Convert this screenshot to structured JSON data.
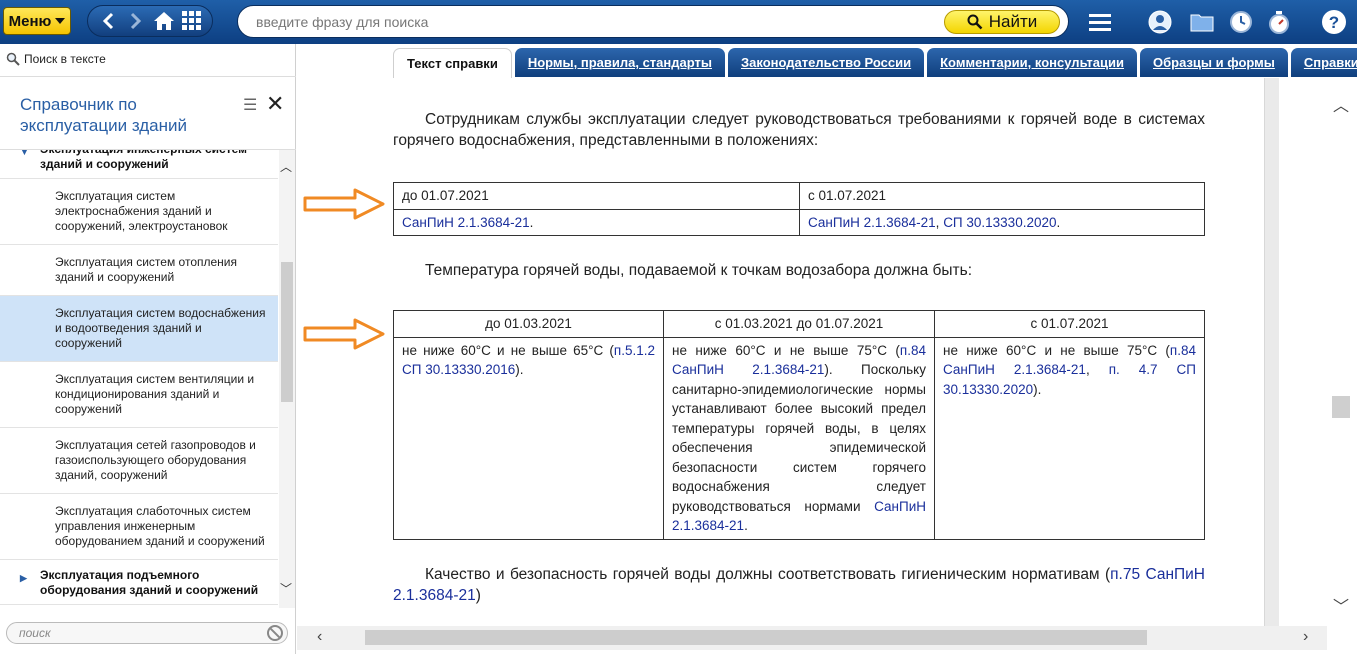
{
  "topbar": {
    "menu_label": "Меню",
    "search_placeholder": "введите фразу для поиска",
    "find_label": "Найти"
  },
  "left_panel": {
    "search_in_text_label": "Поиск в тексте",
    "title": "Справочник по эксплуатации зданий",
    "tree": [
      {
        "label": "Эксплуатация инженерных систем зданий и сооружений",
        "parent": true
      },
      {
        "label": "Эксплуатация систем электроснабжения зданий и сооружений, электроустановок"
      },
      {
        "label": "Эксплуатация систем отопления зданий и сооружений"
      },
      {
        "label": "Эксплуатация систем водоснабжения и водоотведения зданий и сооружений",
        "selected": true
      },
      {
        "label": "Эксплуатация систем вентиляции и кондиционирования зданий и сооружений"
      },
      {
        "label": "Эксплуатация сетей газопроводов и газоиспользующего оборудования зданий, сооружений"
      },
      {
        "label": "Эксплуатация слаботочных систем управления инженерным оборудованием зданий и сооружений"
      },
      {
        "label": "Эксплуатация подъемного оборудования зданий и сооружений",
        "parent": true
      }
    ],
    "filter_placeholder": "поиск"
  },
  "tabs": [
    {
      "label": "Текст справки",
      "active": true
    },
    {
      "label": "Нормы, правила, стандарты"
    },
    {
      "label": "Законодательство России"
    },
    {
      "label": "Комментарии, консультации"
    },
    {
      "label": "Образцы и формы"
    },
    {
      "label": "Справки"
    }
  ],
  "document": {
    "para1": "Сотрудникам службы эксплуатации следует руководствоваться требованиями к горячей воде в системах горячего водоснабжения, представленными в положениях:",
    "table1": {
      "headers": [
        "до 01.07.2021",
        "с 01.07.2021"
      ],
      "row": {
        "c1_link": "СанПиН 2.1.3684-21",
        "c1_tail": ".",
        "c2_link1": "СанПиН 2.1.3684-21",
        "c2_sep": ", ",
        "c2_link2": "СП 30.13330.2020",
        "c2_tail": "."
      }
    },
    "para2": "Температура горячей воды, подаваемой к точкам водозабора должна быть:",
    "table2": {
      "headers": [
        "до 01.03.2021",
        "с 01.03.2021 до 01.07.2021",
        "с 01.07.2021"
      ],
      "c1_text": "не ниже 60°С и не выше 65°С (",
      "c1_link": "п.5.1.2 СП 30.13330.2016",
      "c1_tail": ").",
      "c2_text": "не ниже 60°С и не выше 75°С (",
      "c2_link1": "п.84 СанПиН 2.1.3684-21",
      "c2_mid": "). Поскольку санитарно-эпидемиологические нормы устанавливают более высокий предел температуры горячей воды, в целях обеспечения эпидемической безопасности систем горячего водоснабжения следует руководствоваться нормами ",
      "c2_link2": "СанПиН 2.1.3684-21",
      "c2_tail": ".",
      "c3_text": "не ниже 60°С и не выше 75°С (",
      "c3_link1": "п.84 СанПиН 2.1.3684-21",
      "c3_sep": ", ",
      "c3_link2": "п. 4.7 СП 30.13330.2020",
      "c3_tail": ")."
    },
    "para3_text": "Качество и безопасность горячей воды должны соответствовать гигиеническим нормативам (",
    "para3_link": "п.75 СанПиН 2.1.3684-21",
    "para3_tail": ")"
  },
  "colors": {
    "topbar": "#1a5199",
    "accent_yellow": "#f5c400",
    "link": "#1a2f9b",
    "annotation_arrow": "#f08a24",
    "selected_item": "#cfe3f8"
  },
  "icons": [
    "back-icon",
    "forward-icon",
    "home-icon",
    "grid-icon",
    "search-icon",
    "hamburger-icon",
    "user-icon",
    "folder-icon",
    "clock-icon",
    "stopwatch-icon",
    "help-icon",
    "close-icon",
    "list-icon"
  ]
}
